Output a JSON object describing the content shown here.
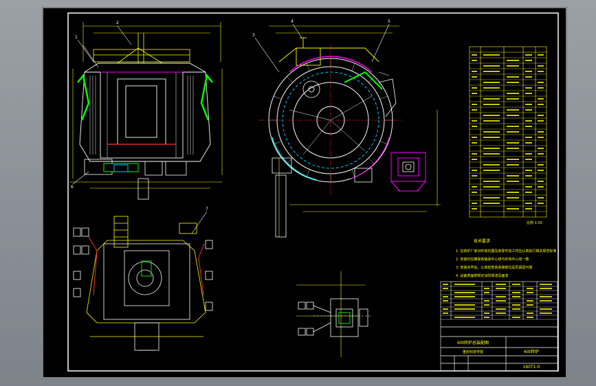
{
  "drawing": {
    "tech_req_title": "技术要求",
    "tech_req_lines": [
      "1. 在转炉厂家对炉体托圈及各零件加工时应认真执行相关规范标准",
      "2. 安装时应确保各轴承中心线与炉体中心线一致",
      "3. 安装完毕后，认真检查各连接部位是否紧固可靠",
      "4. 设备表面按规定涂防锈漆及面漆"
    ],
    "scale_note": "比例 1:50",
    "title_block": {
      "drawing_title": "60t转炉总装配图",
      "product_name": "60t转炉",
      "drawing_no": "160T1-0",
      "school": "重庆科技学院"
    },
    "leader_numbers": [
      "1",
      "2",
      "3",
      "4",
      "5",
      "6",
      "7"
    ]
  },
  "colors": {
    "background": "#000000",
    "primary_line": "#ffffff",
    "dimension": "#ffff00",
    "annotation": "#00ff00",
    "accent_blue": "#00c8ff",
    "accent_magenta": "#ff00ff",
    "accent_red": "#ff3030",
    "accent_cyan": "#00ffff"
  }
}
